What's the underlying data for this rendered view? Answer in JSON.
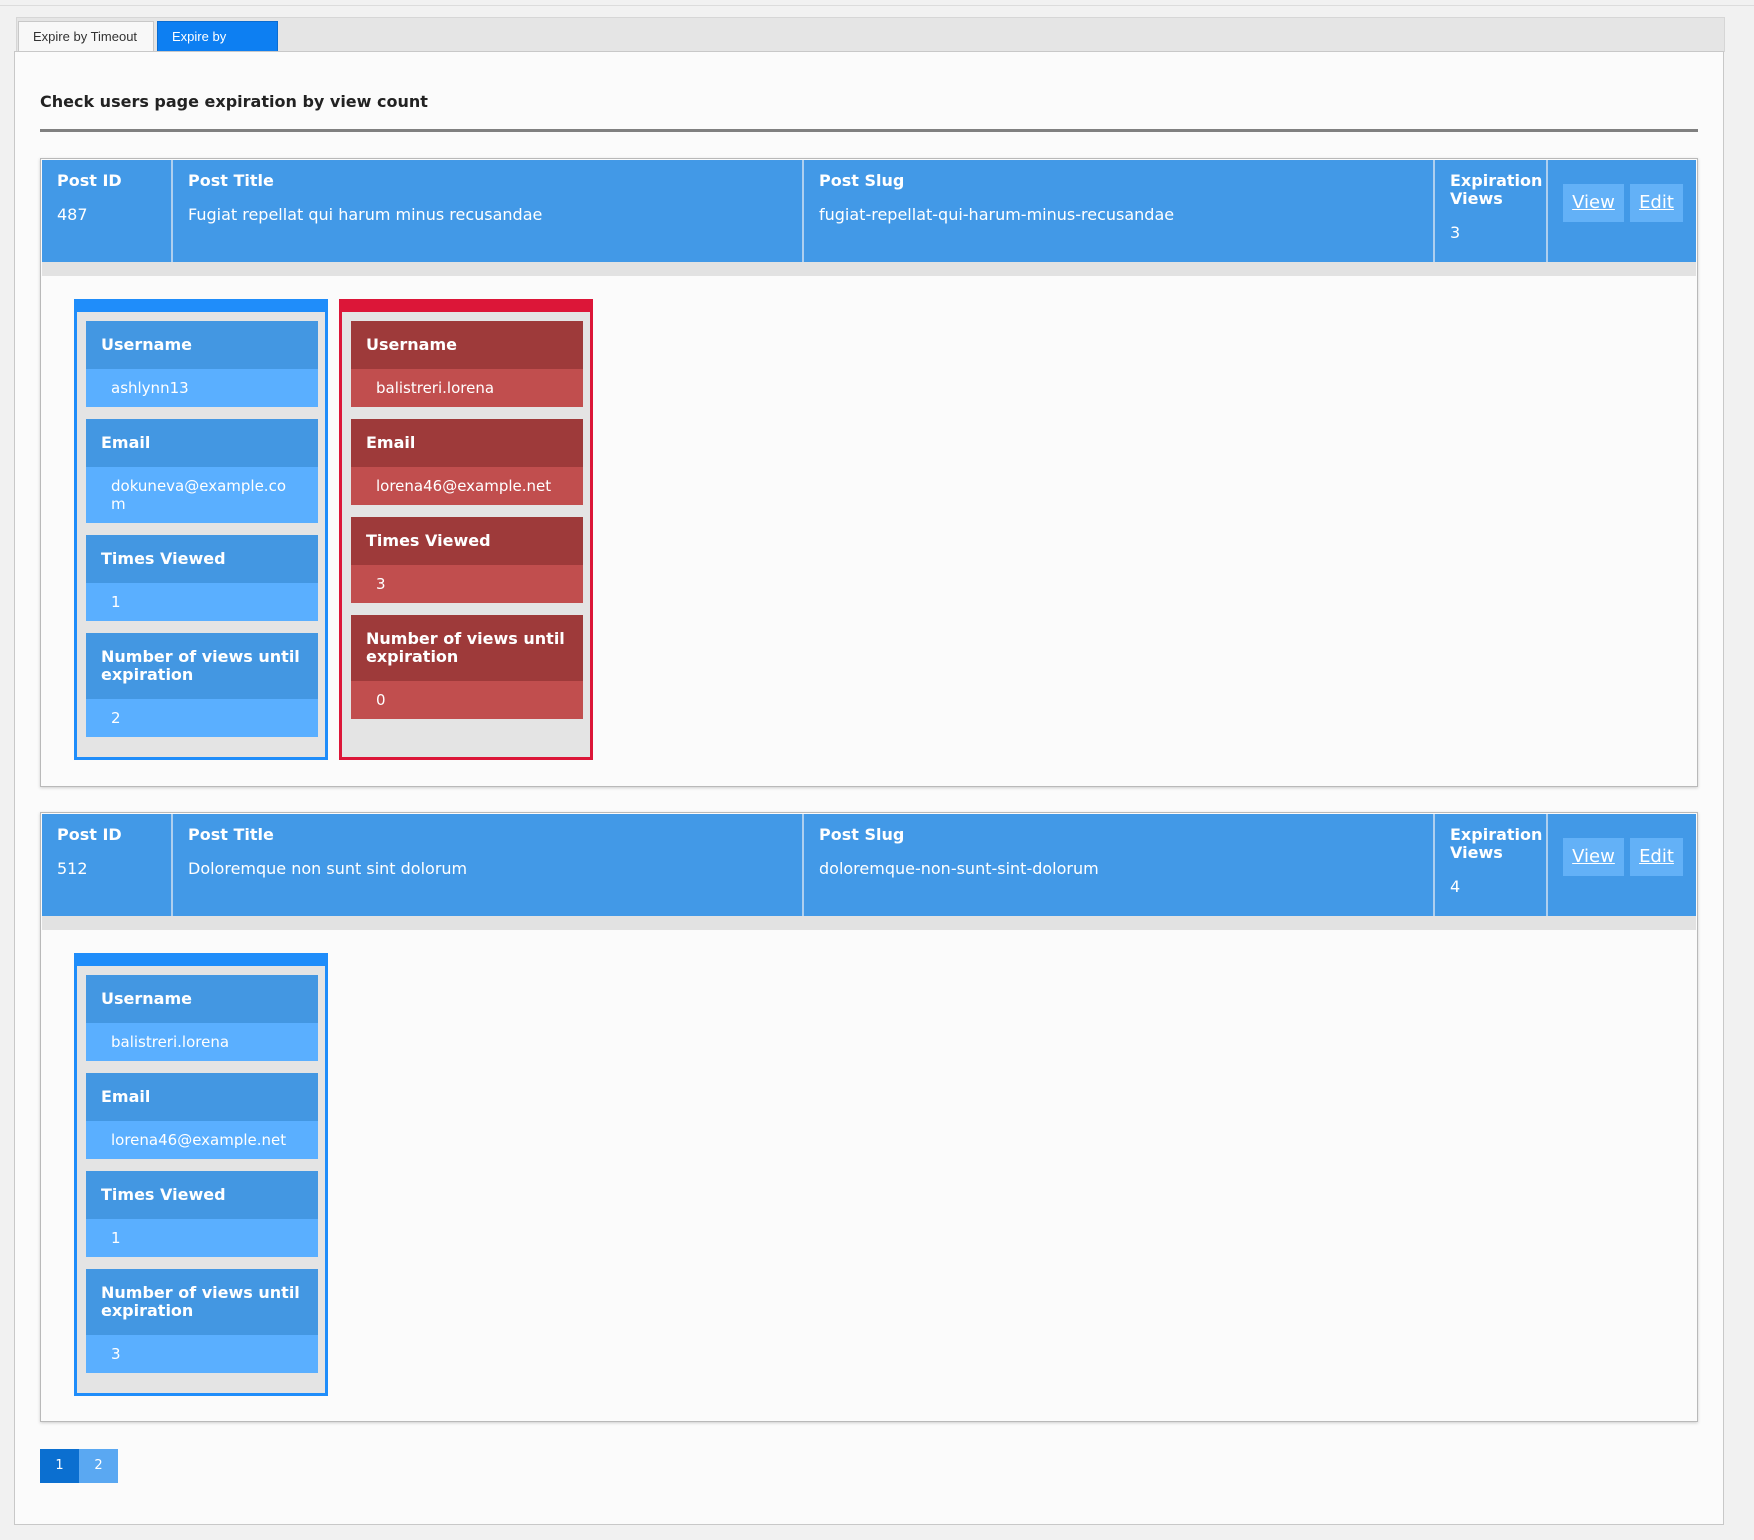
{
  "tabs": [
    {
      "label": "Expire by Timeout",
      "active": false
    },
    {
      "label": "Expire by Views",
      "active": true
    }
  ],
  "heading": "Check users page expiration by view count",
  "columns": {
    "post_id": "Post ID",
    "post_title": "Post Title",
    "post_slug": "Post Slug",
    "expiration_views": "Expiration Views"
  },
  "actions": {
    "view": "View",
    "edit": "Edit"
  },
  "field_labels": {
    "username": "Username",
    "email": "Email",
    "times_viewed": "Times Viewed",
    "views_until_expiration": "Number of views until expiration"
  },
  "posts": [
    {
      "id": "487",
      "title": "Fugiat repellat qui harum minus recusandae",
      "slug": "fugiat-repellat-qui-harum-minus-recusandae",
      "expiration_views": "3",
      "users": [
        {
          "username": "ashlynn13",
          "email": "dokuneva@example.com",
          "times_viewed": "1",
          "views_until_expiration": "2",
          "status": "active"
        },
        {
          "username": "balistreri.lorena",
          "email": "lorena46@example.net",
          "times_viewed": "3",
          "views_until_expiration": "0",
          "status": "expired"
        }
      ]
    },
    {
      "id": "512",
      "title": "Doloremque non sunt sint dolorum",
      "slug": "doloremque-non-sunt-sint-dolorum",
      "expiration_views": "4",
      "users": [
        {
          "username": "balistreri.lorena",
          "email": "lorena46@example.net",
          "times_viewed": "1",
          "views_until_expiration": "3",
          "status": "active"
        }
      ]
    }
  ],
  "pagination": {
    "pages": [
      "1",
      "2"
    ],
    "current": "1"
  },
  "colors": {
    "header_blue": "#4299e7",
    "active_border": "#1f8dfa",
    "expired_border": "#dc1638",
    "label_blue": "#4397e2",
    "value_blue": "#5aafff",
    "label_red": "#9e3a3a",
    "value_red": "#c14e4e",
    "tab_active": "#0d7ff2"
  }
}
